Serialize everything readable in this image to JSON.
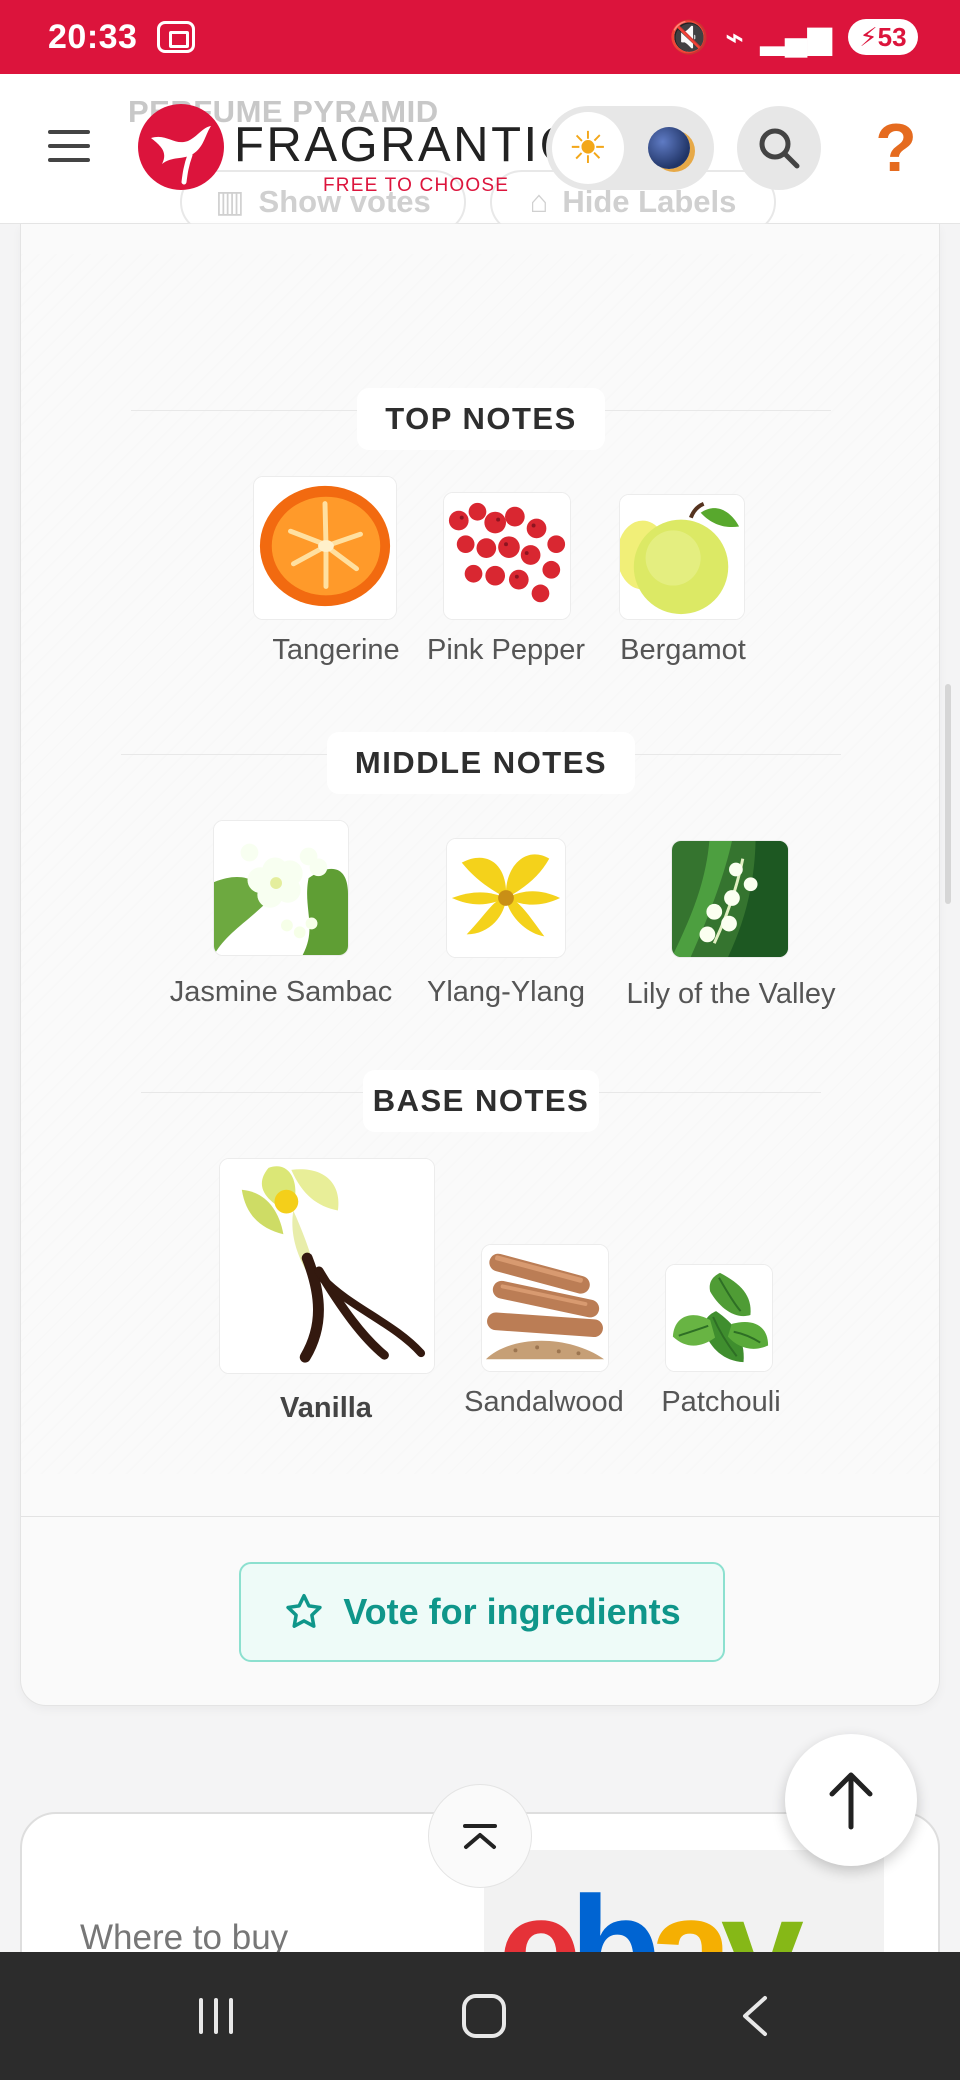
{
  "status_bar": {
    "time": "20:33",
    "battery": "53",
    "mute_icon": "mute-icon",
    "wifi_icon": "wifi-icon",
    "signal_icon": "signal-icon",
    "screenshot_icon": "screenshot-icon"
  },
  "header": {
    "brand": "FRAGRANTICA",
    "tagline": "FREE TO CHOOSE",
    "background_title": "PERFUME PYRAMID",
    "show_votes": "Show votes",
    "hide_labels": "Hide Labels",
    "theme_light_icon": "sun-icon",
    "theme_dark_icon": "moon-icon",
    "search_icon": "search-icon",
    "help_icon": "question-head-icon",
    "brand_color": "#dc143c"
  },
  "pyramid": {
    "top": {
      "title": "TOP NOTES",
      "items": [
        {
          "label": "Tangerine"
        },
        {
          "label": "Pink Pepper"
        },
        {
          "label": "Bergamot"
        }
      ]
    },
    "middle": {
      "title": "MIDDLE NOTES",
      "items": [
        {
          "label": "Jasmine Sambac"
        },
        {
          "label": "Ylang-Ylang"
        },
        {
          "label": "Lily of the Valley"
        }
      ]
    },
    "base": {
      "title": "BASE NOTES",
      "items": [
        {
          "label": "Vanilla"
        },
        {
          "label": "Sandalwood"
        },
        {
          "label": "Patchouli"
        }
      ]
    },
    "vote_button": "Vote for ingredients",
    "vote_icon": "star-icon"
  },
  "bottom": {
    "where_to_buy": "Where to buy",
    "retailer_logo": "ebay",
    "collapse_icon": "chevron-up-icon",
    "back_to_top_icon": "arrow-up-icon"
  },
  "android_nav": {
    "recents_icon": "recents-icon",
    "home_icon": "home-icon",
    "back_icon": "back-icon"
  }
}
